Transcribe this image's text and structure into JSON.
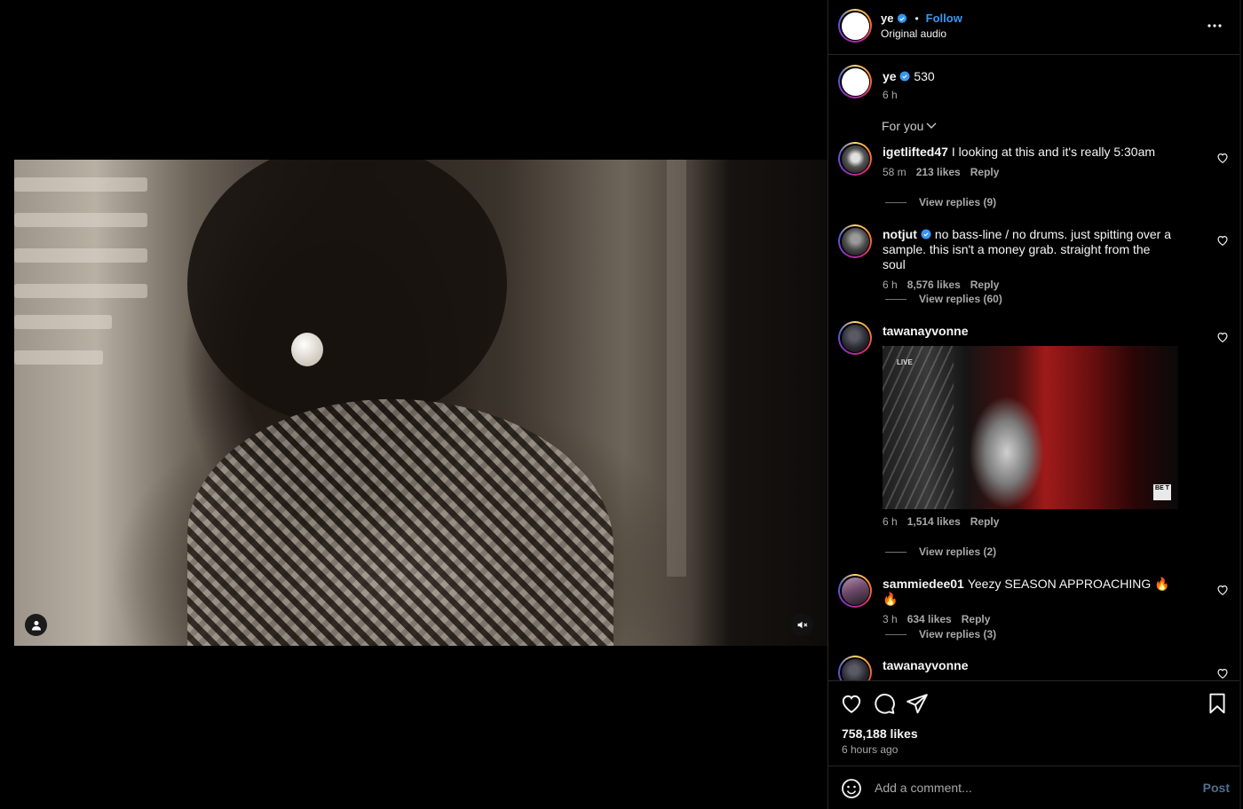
{
  "header": {
    "username": "ye",
    "follow_label": "Follow",
    "separator": "•",
    "audio": "Original audio"
  },
  "caption": {
    "username": "ye",
    "text": "530",
    "time": "6 h"
  },
  "sort_label": "For you",
  "comments": [
    {
      "username": "igetlifted47",
      "verified": false,
      "text": "I looking at this and it's really 5:30am",
      "time": "58 m",
      "likes": "213 likes",
      "reply": "Reply",
      "view_replies": "View replies (9)"
    },
    {
      "username": "notjut",
      "verified": true,
      "text": "no bass-line / no drums. just spitting over a sample. this isn't a money grab. straight from the soul",
      "time": "6 h",
      "likes": "8,576 likes",
      "reply": "Reply",
      "view_replies": "View replies (60)"
    },
    {
      "username": "tawanayvonne",
      "verified": false,
      "text": "",
      "gif_live": "LIVE",
      "gif_badge": "BE T",
      "time": "6 h",
      "likes": "1,514 likes",
      "reply": "Reply",
      "view_replies": "View replies (2)"
    },
    {
      "username": "sammiedee01",
      "verified": false,
      "text": "Yeezy SEASON APPROACHING 🔥🔥",
      "time": "3 h",
      "likes": "634 likes",
      "reply": "Reply",
      "view_replies": "View replies (3)"
    },
    {
      "username": "tawanayvonne",
      "verified": false,
      "text": ""
    }
  ],
  "footer": {
    "likes_count": "758,188 likes",
    "posted_ago": "6 hours ago"
  },
  "add_comment": {
    "placeholder": "Add a comment...",
    "post_label": "Post"
  },
  "icons": {
    "video_user": "user-icon",
    "mute": "muted-speaker-icon",
    "more": "more-horizontal-icon",
    "like": "heart-icon",
    "comment": "comment-bubble-icon",
    "share": "paper-plane-icon",
    "save": "bookmark-icon",
    "emoji": "smiley-icon",
    "verified": "verified-badge-icon"
  },
  "colors": {
    "follow": "#3897f0",
    "verified": "#3897f0",
    "secondary_text": "#a8a8a8",
    "post_button_disabled": "#4d6f8f"
  }
}
